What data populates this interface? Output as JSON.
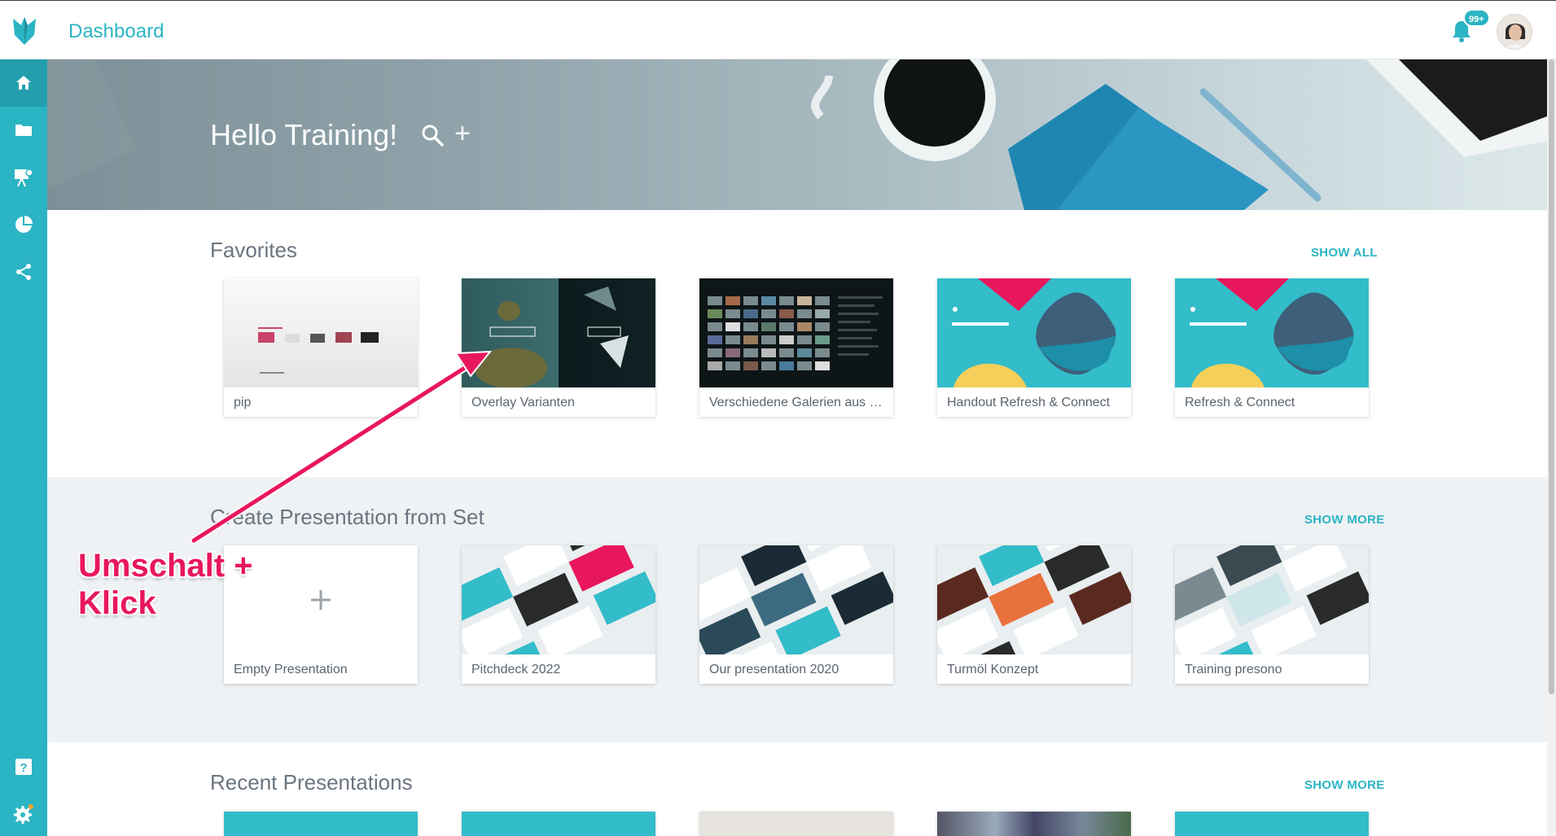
{
  "header": {
    "title": "Dashboard",
    "notification_badge": "99+"
  },
  "sidebar": {
    "items": [
      {
        "icon": "home-icon"
      },
      {
        "icon": "folder-icon"
      },
      {
        "icon": "presentation-icon"
      },
      {
        "icon": "pie-chart-icon"
      },
      {
        "icon": "share-icon"
      },
      {
        "icon": "help-icon"
      },
      {
        "icon": "gear-icon"
      }
    ]
  },
  "hero": {
    "greeting": "Hello Training!",
    "plus": "+"
  },
  "favorites": {
    "title": "Favorites",
    "link": "SHOW ALL",
    "items": [
      {
        "label": "pip"
      },
      {
        "label": "Overlay Varianten"
      },
      {
        "label": "Verschiedene Galerien aus a..."
      },
      {
        "label": "Handout Refresh & Connect"
      },
      {
        "label": "Refresh & Connect"
      }
    ]
  },
  "sets": {
    "title": "Create Presentation from Set",
    "link": "SHOW MORE",
    "items": [
      {
        "label": "Empty Presentation"
      },
      {
        "label": "Pitchdeck 2022"
      },
      {
        "label": "Our presentation 2020"
      },
      {
        "label": "Turmöl Konzept"
      },
      {
        "label": "Training presono"
      }
    ]
  },
  "recent": {
    "title": "Recent Presentations",
    "link": "SHOW MORE"
  },
  "annotation": {
    "line1": "Umschalt +",
    "line2": "Klick"
  },
  "colors": {
    "accent": "#2bb4c3",
    "annotation": "#e8175d"
  }
}
